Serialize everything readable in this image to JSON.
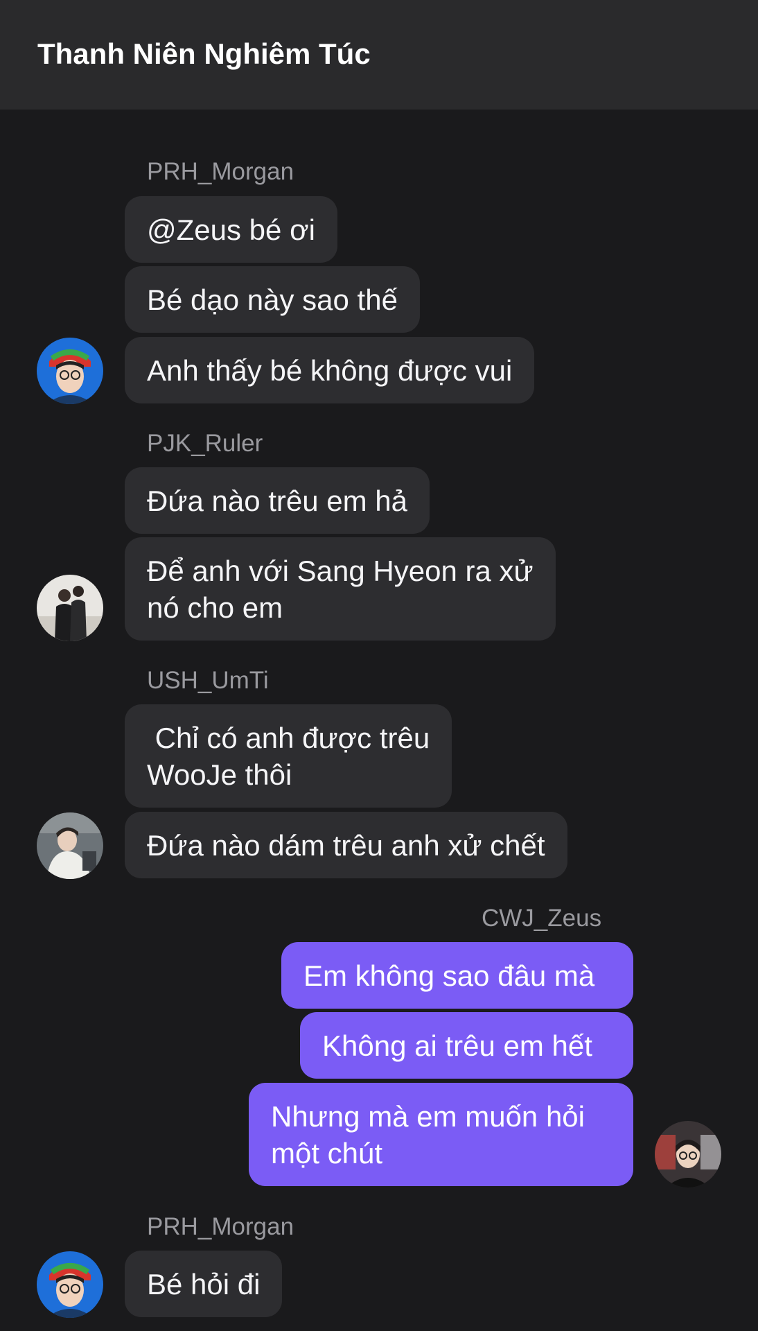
{
  "header": {
    "title": "Thanh Niên Nghiêm Túc"
  },
  "groups": [
    {
      "sender": "PRH_Morgan",
      "messages": [
        "@Zeus bé ơi",
        "Bé dạo này sao thế",
        "Anh thấy bé không được vui"
      ]
    },
    {
      "sender": "PJK_Ruler",
      "messages": [
        "Đứa nào trêu em hả",
        "Để anh với Sang Hyeon ra xử\nnó cho em"
      ]
    },
    {
      "sender": "USH_UmTi",
      "messages": [
        " Chỉ có anh được trêu\nWooJe thôi",
        "Đứa nào dám trêu anh xử chết"
      ]
    },
    {
      "sender": "CWJ_Zeus",
      "messages": [
        "Em không sao đâu mà",
        "Không ai trêu em hết",
        "Nhưng mà em muốn hỏi\nmột chút"
      ]
    },
    {
      "sender": "PRH_Morgan",
      "messages": [
        "Bé hỏi đi"
      ]
    }
  ],
  "colors": {
    "background": "#1a1a1c",
    "header": "#2a2a2c",
    "incoming_bubble": "#2d2d30",
    "outgoing_bubble": "#7b5cf5"
  }
}
